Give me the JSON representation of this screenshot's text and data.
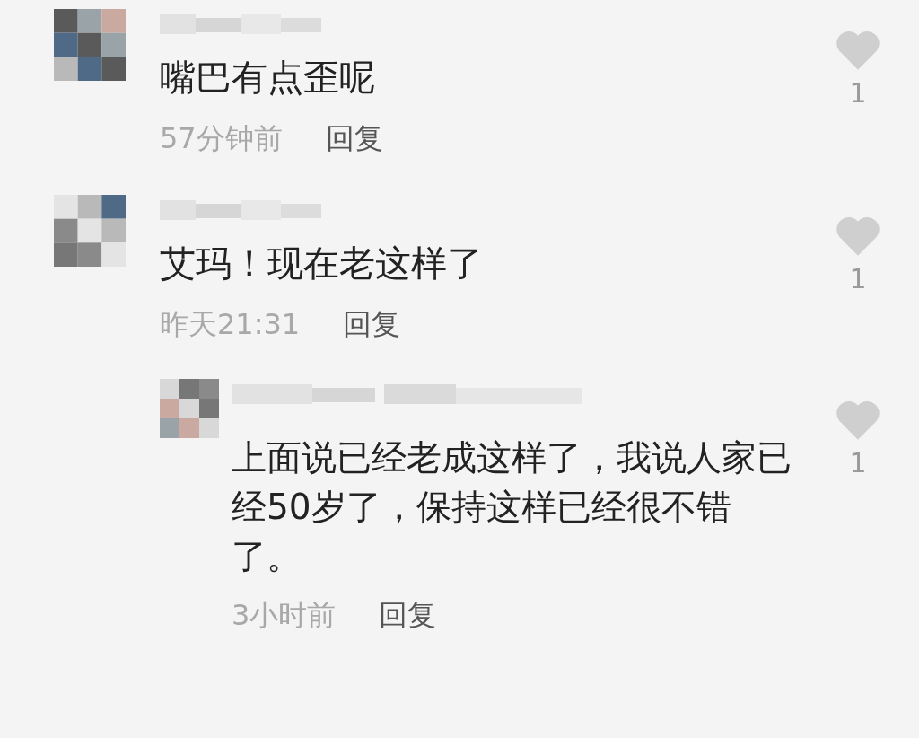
{
  "comments": [
    {
      "text": "嘴巴有点歪呢",
      "time": "57分钟前",
      "reply_label": "回复",
      "likes": "1"
    },
    {
      "text": "艾玛！现在老这样了",
      "time": "昨天21:31",
      "reply_label": "回复",
      "likes": "1",
      "replies": [
        {
          "text": "上面说已经老成这样了，我说人家已经50岁了，保持这样已经很不错了。",
          "time": "3小时前",
          "reply_label": "回复",
          "likes": "1"
        }
      ]
    }
  ]
}
